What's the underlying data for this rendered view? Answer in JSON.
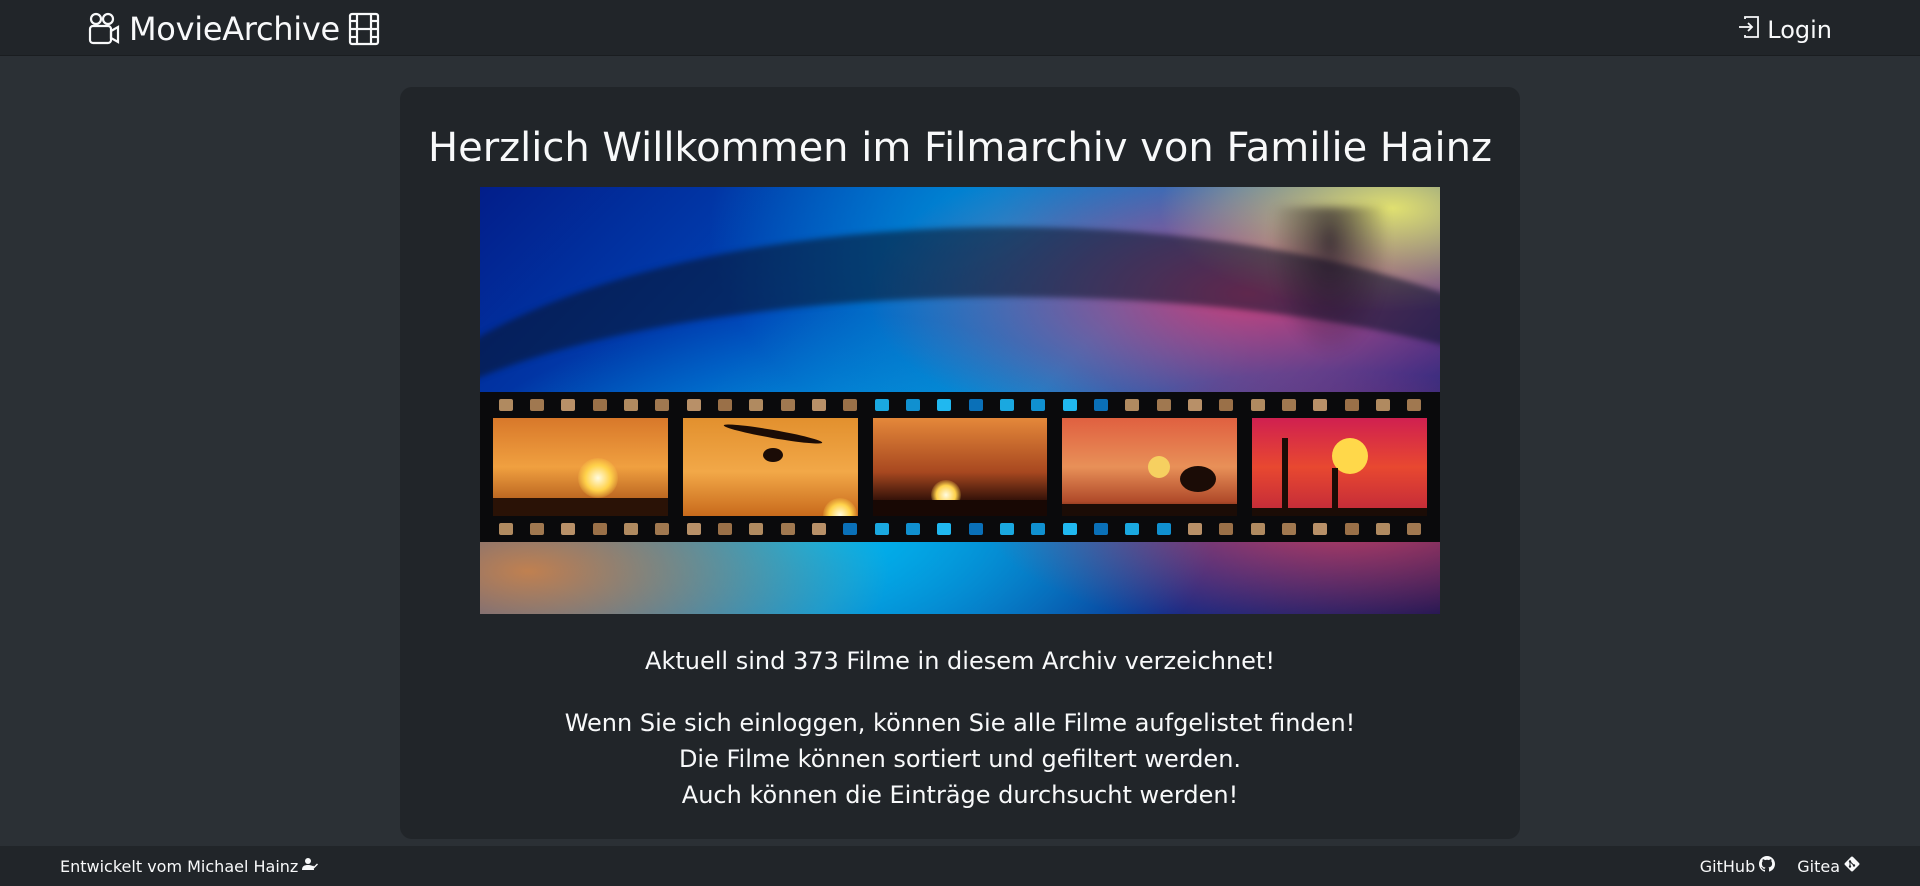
{
  "nav": {
    "brand": "MovieArchive",
    "brand_icon_left": "video-camera-icon",
    "brand_icon_right": "film-icon",
    "login_label": "Login",
    "login_icon": "box-arrow-in-right-icon"
  },
  "main": {
    "title": "Herzlich Willkommen im Filmarchiv von Familie Hainz",
    "hero_image": "film-strip-sunset-banner",
    "count_text": "Aktuell sind 373 Filme in diesem Archiv verzeichnet!",
    "info_lines": [
      "Wenn Sie sich einloggen, können Sie alle Filme aufgelistet finden!",
      "Die Filme können sortiert und gefiltert werden.",
      "Auch können die Einträge durchsucht werden!"
    ]
  },
  "footer": {
    "credit": "Entwickelt vom Michael Hainz",
    "credit_icon": "person-check-icon",
    "links": [
      {
        "label": "GitHub",
        "icon": "github-icon"
      },
      {
        "label": "Gitea",
        "icon": "git-icon"
      }
    ]
  },
  "colors": {
    "page_bg": "#2b3035",
    "navbar_bg": "#212529",
    "card_bg": "#212529",
    "text": "#f8f9fa"
  }
}
